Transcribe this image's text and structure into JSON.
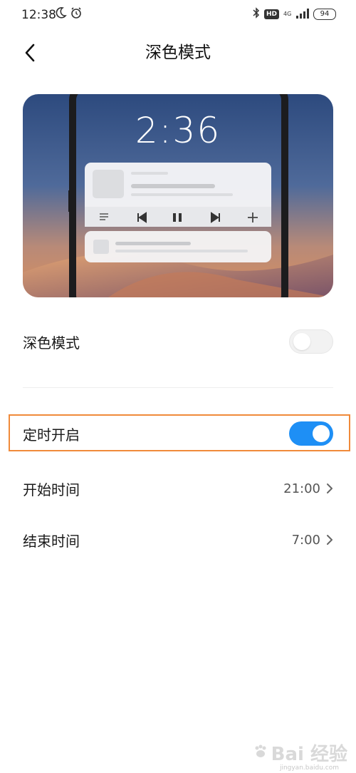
{
  "status_bar": {
    "time": "12:38",
    "hd": "HD",
    "network": "4G",
    "battery": "94"
  },
  "header": {
    "title": "深色模式"
  },
  "preview": {
    "clock": "2:36"
  },
  "settings": {
    "dark_mode": {
      "label": "深色模式",
      "enabled": false
    },
    "scheduled": {
      "label": "定时开启",
      "enabled": true
    },
    "start_time": {
      "label": "开始时间",
      "value": "21:00"
    },
    "end_time": {
      "label": "结束时间",
      "value": "7:00"
    }
  },
  "colors": {
    "accent": "#1e8ff5",
    "highlight": "#f08a3a"
  },
  "watermark": {
    "main": "Bai 经验",
    "sub": "jingyan.baidu.com"
  }
}
